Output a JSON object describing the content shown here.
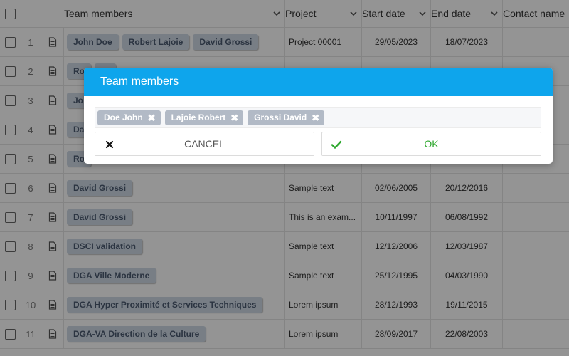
{
  "grid": {
    "headers": {
      "team": "Team members",
      "project": "Project",
      "start": "Start date",
      "end": "End date",
      "contact": "Contact name"
    },
    "rows": [
      {
        "num": "1",
        "team": [
          "John Doe",
          "Robert Lajoie",
          "David Grossi"
        ],
        "project": "Project 00001",
        "start": "29/05/2023",
        "end": "18/07/2023"
      },
      {
        "num": "2",
        "team": [
          "Ro",
          "ro"
        ],
        "project": "",
        "start": "",
        "end": ""
      },
      {
        "num": "3",
        "team": [
          "Jo"
        ],
        "project": "",
        "start": "",
        "end": ""
      },
      {
        "num": "4",
        "team": [
          "Da"
        ],
        "project": "",
        "start": "",
        "end": ""
      },
      {
        "num": "5",
        "team": [
          "Ro"
        ],
        "project": "",
        "start": "",
        "end": ""
      },
      {
        "num": "6",
        "team": [
          "David Grossi"
        ],
        "project": "Sample text",
        "start": "02/06/2005",
        "end": "20/12/2016"
      },
      {
        "num": "7",
        "team": [
          "David Grossi"
        ],
        "project": "This is an exam...",
        "start": "10/11/1997",
        "end": "06/08/1992"
      },
      {
        "num": "8",
        "team": [
          "DSCI validation"
        ],
        "project": "Sample text",
        "start": "12/12/2006",
        "end": "12/03/1987"
      },
      {
        "num": "9",
        "team": [
          "DGA Ville Moderne"
        ],
        "project": "Sample text",
        "start": "25/12/1995",
        "end": "04/03/1990"
      },
      {
        "num": "10",
        "team": [
          "DGA Hyper Proximité et Services Techniques"
        ],
        "project": "Lorem ipsum",
        "start": "28/12/1993",
        "end": "19/11/2015"
      },
      {
        "num": "11",
        "team": [
          "DGA-VA Direction de la Culture"
        ],
        "project": "Lorem ipsum",
        "start": "28/09/2017",
        "end": "22/08/2003"
      }
    ]
  },
  "dialog": {
    "title": "Team members",
    "chips": [
      "Doe John",
      "Lajoie Robert",
      "Grossi David"
    ],
    "cancel_label": "CANCEL",
    "ok_label": "OK"
  },
  "colors": {
    "header_accent": "#0ea5ec",
    "ok_green": "#2ea82e",
    "tag_bg": "#cfd9e6",
    "chip_bg": "#b2bac6"
  }
}
